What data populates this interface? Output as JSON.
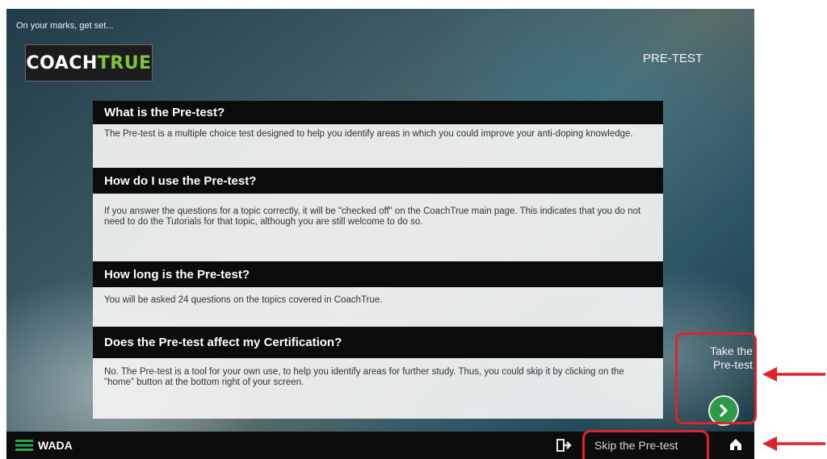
{
  "header": {
    "tagline": "On your marks, get set...",
    "logo_white": "COACH",
    "logo_green": "TRUE",
    "section_label": "PRE-TEST"
  },
  "sections": [
    {
      "heading": "What is the Pre-test?",
      "body": "The Pre-test is a multiple choice test designed to help you identify areas in which you could improve your anti-doping knowledge."
    },
    {
      "heading": "How do I use the Pre-test?",
      "body": "If you answer the questions for a topic correctly, it will be \"checked off\" on the CoachTrue main page. This indicates that you do not need to do the Tutorials for that topic, although you are still welcome to do so."
    },
    {
      "heading": "How long is the Pre-test?",
      "body": "You will be asked 24 questions on the topics covered in CoachTrue."
    },
    {
      "heading": "Does the Pre-test affect my Certification?",
      "body": "No. The Pre-test is a tool for your own use, to help you identify areas for further study. Thus, you could skip it by clicking on the \"home\" button at the bottom right of your screen."
    }
  ],
  "take_pretest": {
    "line1": "Take the",
    "line2": "Pre-test"
  },
  "footer": {
    "brand": "WADA",
    "skip_label": "Skip the Pre-test"
  },
  "colors": {
    "accent_green": "#7fc43a",
    "button_green": "#2e9a47",
    "annotation_red": "#e0222a"
  },
  "icons": [
    "wada-logo-icon",
    "exit-icon",
    "home-icon",
    "chevron-right-icon",
    "arrow-left-icon"
  ]
}
